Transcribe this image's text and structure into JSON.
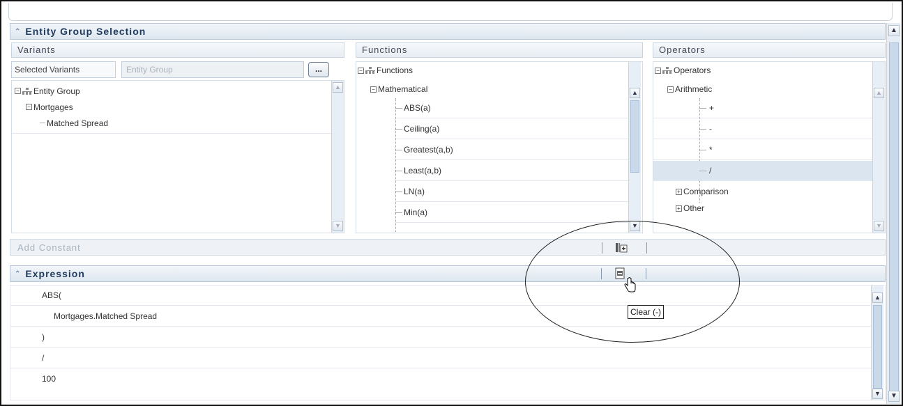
{
  "entity_section": {
    "title": "Entity Group Selection"
  },
  "variants": {
    "header": "Variants",
    "selected_label": "Selected Variants",
    "input_placeholder": "Entity Group",
    "browse_button": "...",
    "tree": {
      "root": "Entity Group",
      "child": "Mortgages",
      "leaf": "Matched Spread"
    }
  },
  "functions": {
    "header": "Functions",
    "root": "Functions",
    "group": "Mathematical",
    "items": [
      "ABS(a)",
      "Ceiling(a)",
      "Greatest(a,b)",
      "Least(a,b)",
      "LN(a)",
      "Min(a)"
    ]
  },
  "operators": {
    "header": "Operators",
    "root": "Operators",
    "group": "Arithmetic",
    "items": [
      "+",
      "-",
      "*",
      "/"
    ],
    "collapsed_groups": [
      "Comparison",
      "Other"
    ]
  },
  "constant": {
    "label": "Add Constant"
  },
  "expression": {
    "title": "Expression",
    "lines": [
      "ABS(",
      "Mortgages.Matched Spread",
      ")",
      "/",
      "100"
    ]
  },
  "tooltip": {
    "text": "Clear (-)"
  }
}
